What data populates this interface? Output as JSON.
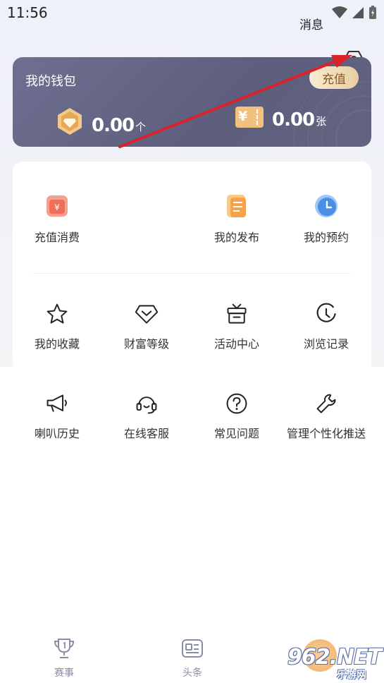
{
  "status_bar": {
    "time": "11:56"
  },
  "header": {
    "messages_label": "消息"
  },
  "wallet": {
    "title": "我的钱包",
    "recharge_button": "充值",
    "coins": {
      "value": "0.00",
      "unit": "个"
    },
    "tickets": {
      "value": "0.00",
      "unit": "张"
    },
    "ticket_glyph": "¥"
  },
  "menu": {
    "row1": [
      {
        "label": "充值消费",
        "icon": "recharge-record-icon"
      },
      {
        "label": "我的发布",
        "icon": "my-posts-icon"
      },
      {
        "label": "我的预约",
        "icon": "reservation-clock-icon"
      }
    ],
    "row2": [
      {
        "label": "我的收藏",
        "icon": "star-icon"
      },
      {
        "label": "财富等级",
        "icon": "heart-badge-icon"
      },
      {
        "label": "活动中心",
        "icon": "gift-box-icon"
      },
      {
        "label": "浏览记录",
        "icon": "history-clock-icon"
      }
    ],
    "row3": [
      {
        "label": "喇叭历史",
        "icon": "megaphone-icon"
      },
      {
        "label": "在线客服",
        "icon": "headset-icon"
      },
      {
        "label": "常见问题",
        "icon": "question-icon"
      },
      {
        "label": "管理个性化推送",
        "icon": "wrench-icon"
      }
    ]
  },
  "tabbar": {
    "tabs": [
      {
        "label": "赛事",
        "icon": "trophy-icon"
      },
      {
        "label": "头条",
        "icon": "news-card-icon"
      }
    ]
  },
  "watermark": {
    "text": "962.NET",
    "subtext": "乐游网"
  },
  "colors": {
    "accent_arrow": "#d9232b",
    "wallet_bg": "#62647f",
    "recharge_text": "#8a5a24"
  }
}
